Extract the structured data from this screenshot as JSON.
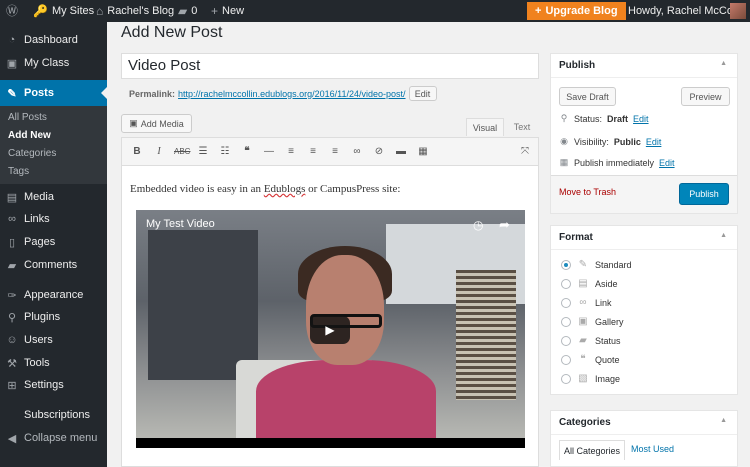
{
  "adminbar": {
    "my_sites": "My Sites",
    "blog_name": "Rachel's Blog",
    "comments_count": "0",
    "new_label": "New",
    "upgrade": "Upgrade Blog",
    "greeting": "Howdy, Rachel McCollin"
  },
  "sidebar": {
    "items": [
      {
        "label": "Dashboard",
        "icon": "dashboard-icon"
      },
      {
        "label": "My Class",
        "icon": "class-icon"
      },
      {
        "label": "Posts",
        "icon": "pin-icon"
      },
      {
        "label": "Media",
        "icon": "media-icon"
      },
      {
        "label": "Links",
        "icon": "links-icon"
      },
      {
        "label": "Pages",
        "icon": "pages-icon"
      },
      {
        "label": "Comments",
        "icon": "comments-icon"
      },
      {
        "label": "Appearance",
        "icon": "appearance-icon"
      },
      {
        "label": "Plugins",
        "icon": "plugins-icon"
      },
      {
        "label": "Users",
        "icon": "users-icon"
      },
      {
        "label": "Tools",
        "icon": "tools-icon"
      },
      {
        "label": "Settings",
        "icon": "settings-icon"
      },
      {
        "label": "Subscriptions",
        "icon": ""
      },
      {
        "label": "Collapse menu",
        "icon": "collapse-icon"
      }
    ],
    "submenu": [
      "All Posts",
      "Add New",
      "Categories",
      "Tags"
    ]
  },
  "main": {
    "page_title": "Add New Post",
    "post_title": "Video Post",
    "permalink_label": "Permalink:",
    "permalink_url": "http://rachelmccollin.edublogs.org/2016/11/24/video-post/",
    "edit_button": "Edit",
    "add_media": "Add Media",
    "tab_visual": "Visual",
    "tab_text": "Text",
    "content_prefix": "Embedded video is easy in an ",
    "content_squiggle": "Edublogs",
    "content_suffix": " or CampusPress site:",
    "video_title": "My Test Video"
  },
  "publish": {
    "heading": "Publish",
    "save_draft": "Save Draft",
    "preview": "Preview",
    "status_label": "Status:",
    "status_value": "Draft",
    "visibility_label": "Visibility:",
    "visibility_value": "Public",
    "schedule": "Publish immediately",
    "edit": "Edit",
    "trash": "Move to Trash",
    "publish_button": "Publish"
  },
  "format": {
    "heading": "Format",
    "options": [
      "Standard",
      "Aside",
      "Link",
      "Gallery",
      "Status",
      "Quote",
      "Image"
    ],
    "selected": "Standard"
  },
  "categories": {
    "heading": "Categories",
    "tab_all": "All Categories",
    "tab_used": "Most Used"
  },
  "colors": {
    "admin_bg": "#23282d",
    "accent": "#0073aa",
    "upgrade": "#f0821e",
    "publish": "#0085ba"
  }
}
